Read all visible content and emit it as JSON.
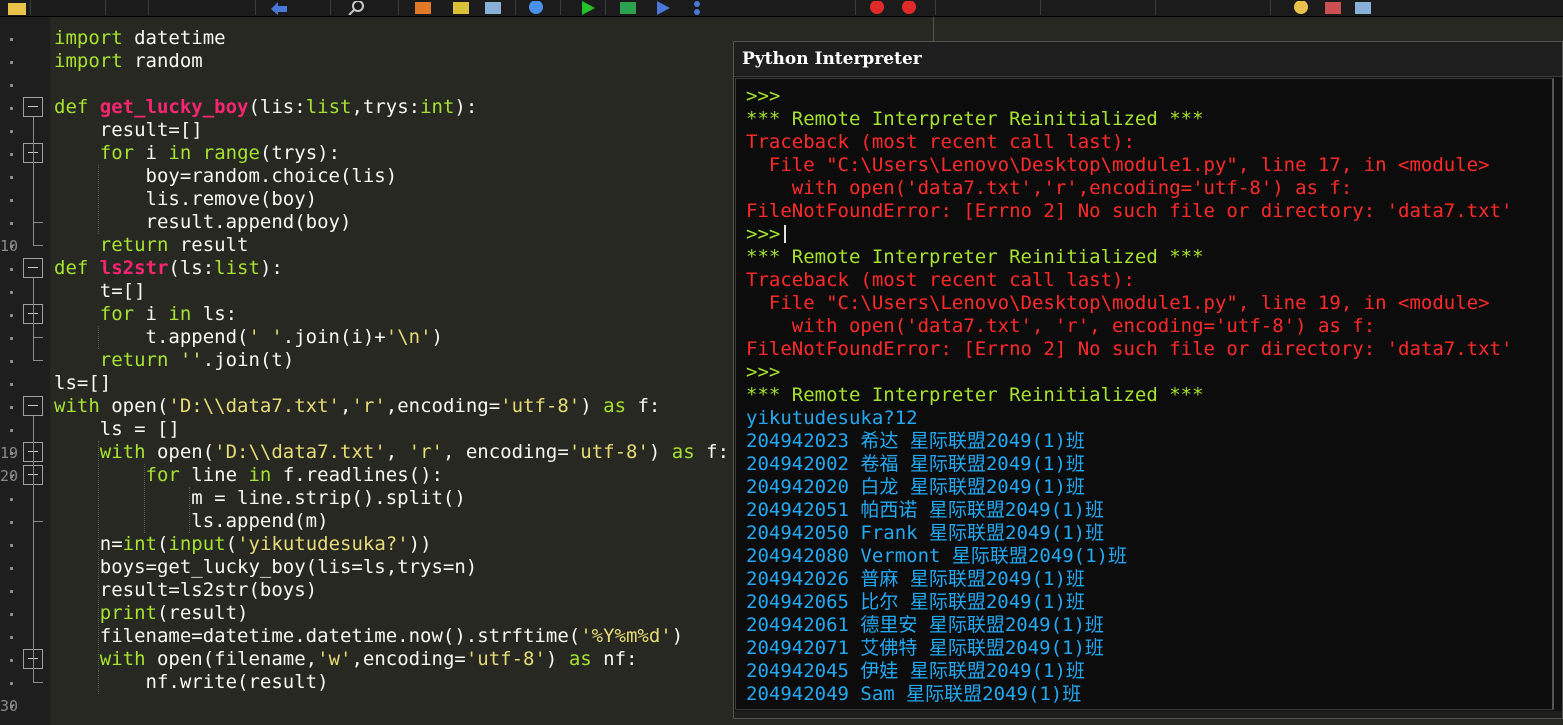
{
  "interpreter": {
    "title": "Python Interpreter",
    "lines": [
      {
        "cls": "prompt",
        "text": ">>>"
      },
      {
        "cls": "reinit",
        "text": "*** Remote Interpreter Reinitialized ***"
      },
      {
        "cls": "err",
        "text": "Traceback (most recent call last):"
      },
      {
        "cls": "err",
        "text": "  File \"C:\\Users\\Lenovo\\Desktop\\module1.py\", line 17, in <module>"
      },
      {
        "cls": "err",
        "text": "    with open('data7.txt','r',encoding='utf-8') as f:"
      },
      {
        "cls": "err",
        "text": "FileNotFoundError: [Errno 2] No such file or directory: 'data7.txt'"
      },
      {
        "cls": "prompt",
        "text": ">>>",
        "cursor": true
      },
      {
        "cls": "reinit",
        "text": "*** Remote Interpreter Reinitialized ***"
      },
      {
        "cls": "err",
        "text": "Traceback (most recent call last):"
      },
      {
        "cls": "err",
        "text": "  File \"C:\\Users\\Lenovo\\Desktop\\module1.py\", line 19, in <module>"
      },
      {
        "cls": "err",
        "text": "    with open('data7.txt', 'r', encoding='utf-8') as f:"
      },
      {
        "cls": "err",
        "text": "FileNotFoundError: [Errno 2] No such file or directory: 'data7.txt'"
      },
      {
        "cls": "prompt",
        "text": ">>>"
      },
      {
        "cls": "reinit",
        "text": "*** Remote Interpreter Reinitialized ***"
      },
      {
        "cls": "out",
        "text": "yikutudesuka?12"
      },
      {
        "cls": "out",
        "text": "204942023 希达 星际联盟2049(1)班"
      },
      {
        "cls": "out",
        "text": "204942002 卷福 星际联盟2049(1)班"
      },
      {
        "cls": "out",
        "text": "204942020 白龙 星际联盟2049(1)班"
      },
      {
        "cls": "out",
        "text": "204942051 帕西诺 星际联盟2049(1)班"
      },
      {
        "cls": "out",
        "text": "204942050 Frank 星际联盟2049(1)班"
      },
      {
        "cls": "out",
        "text": "204942080 Vermont 星际联盟2049(1)班"
      },
      {
        "cls": "out",
        "text": "204942026 普麻 星际联盟2049(1)班"
      },
      {
        "cls": "out",
        "text": "204942065 比尔 星际联盟2049(1)班"
      },
      {
        "cls": "out",
        "text": "204942061 德里安 星际联盟2049(1)班"
      },
      {
        "cls": "out",
        "text": "204942071 艾佛特 星际联盟2049(1)班"
      },
      {
        "cls": "out",
        "text": "204942045 伊娃 星际联盟2049(1)班"
      },
      {
        "cls": "out",
        "text": "204942049 Sam 星际联盟2049(1)班"
      }
    ]
  },
  "gutter": {
    "line_numbers": [
      {
        "text": "10",
        "row": 9
      },
      {
        "text": "19",
        "row": 18
      },
      {
        "text": "20",
        "row": 19
      },
      {
        "text": "30",
        "row": 29
      }
    ]
  },
  "code_lines": [
    [
      [
        "kw",
        "import"
      ],
      [
        "pl",
        " datetime"
      ]
    ],
    [
      [
        "kw",
        "import"
      ],
      [
        "pl",
        " random"
      ]
    ],
    [],
    [
      [
        "kw",
        "def "
      ],
      [
        "fn",
        "get_lucky_boy"
      ],
      [
        "pl",
        "(lis:"
      ],
      [
        "tp",
        "list"
      ],
      [
        "pl",
        ",trys:"
      ],
      [
        "tp",
        "int"
      ],
      [
        "pl",
        "):"
      ]
    ],
    [
      [
        "pl",
        "    result=[]"
      ]
    ],
    [
      [
        "pl",
        "    "
      ],
      [
        "kw",
        "for"
      ],
      [
        "pl",
        " i "
      ],
      [
        "kw",
        "in"
      ],
      [
        "pl",
        " "
      ],
      [
        "kw",
        "range"
      ],
      [
        "pl",
        "(trys):"
      ]
    ],
    [
      [
        "pl",
        "        boy=random.choice(lis)"
      ]
    ],
    [
      [
        "pl",
        "        lis.remove(boy)"
      ]
    ],
    [
      [
        "pl",
        "        result.append(boy)"
      ]
    ],
    [
      [
        "pl",
        "    "
      ],
      [
        "kw",
        "return"
      ],
      [
        "pl",
        " result"
      ]
    ],
    [
      [
        "kw",
        "def "
      ],
      [
        "fn",
        "ls2str"
      ],
      [
        "pl",
        "(ls:"
      ],
      [
        "tp",
        "list"
      ],
      [
        "pl",
        "):"
      ]
    ],
    [
      [
        "pl",
        "    t=[]"
      ]
    ],
    [
      [
        "pl",
        "    "
      ],
      [
        "kw",
        "for"
      ],
      [
        "pl",
        " i "
      ],
      [
        "kw",
        "in"
      ],
      [
        "pl",
        " ls:"
      ]
    ],
    [
      [
        "pl",
        "        t.append("
      ],
      [
        "str",
        "' '"
      ],
      [
        "pl",
        ".join(i)+"
      ],
      [
        "str",
        "'\\n'"
      ],
      [
        "pl",
        ")"
      ]
    ],
    [
      [
        "pl",
        "    "
      ],
      [
        "kw",
        "return"
      ],
      [
        "pl",
        " "
      ],
      [
        "str",
        "''"
      ],
      [
        "pl",
        ".join(t)"
      ]
    ],
    [
      [
        "pl",
        "ls=[]"
      ]
    ],
    [
      [
        "kw",
        "with"
      ],
      [
        "pl",
        " open("
      ],
      [
        "str",
        "'D:\\\\data7.txt'"
      ],
      [
        "pl",
        ","
      ],
      [
        "str",
        "'r'"
      ],
      [
        "pl",
        ",encoding="
      ],
      [
        "str",
        "'utf-8'"
      ],
      [
        "pl",
        ") "
      ],
      [
        "kw",
        "as"
      ],
      [
        "pl",
        " f:"
      ]
    ],
    [
      [
        "pl",
        "    ls = []"
      ]
    ],
    [
      [
        "pl",
        "    "
      ],
      [
        "kw",
        "with"
      ],
      [
        "pl",
        " open("
      ],
      [
        "str",
        "'D:\\\\data7.txt'"
      ],
      [
        "pl",
        ", "
      ],
      [
        "str",
        "'r'"
      ],
      [
        "pl",
        ", encoding="
      ],
      [
        "str",
        "'utf-8'"
      ],
      [
        "pl",
        ") "
      ],
      [
        "kw",
        "as"
      ],
      [
        "pl",
        " f:"
      ]
    ],
    [
      [
        "pl",
        "        "
      ],
      [
        "kw",
        "for"
      ],
      [
        "pl",
        " line "
      ],
      [
        "kw",
        "in"
      ],
      [
        "pl",
        " f.readlines():"
      ]
    ],
    [
      [
        "pl",
        "            m = line.strip().split()"
      ]
    ],
    [
      [
        "pl",
        "            ls.append(m)"
      ]
    ],
    [
      [
        "pl",
        "    n="
      ],
      [
        "kw",
        "int"
      ],
      [
        "pl",
        "("
      ],
      [
        "kw",
        "input"
      ],
      [
        "pl",
        "("
      ],
      [
        "str",
        "'yikutudesuka?'"
      ],
      [
        "pl",
        "))"
      ]
    ],
    [
      [
        "pl",
        "    boys=get_lucky_boy(lis=ls,trys=n)"
      ]
    ],
    [
      [
        "pl",
        "    result=ls2str(boys)"
      ]
    ],
    [
      [
        "pl",
        "    "
      ],
      [
        "kw",
        "print"
      ],
      [
        "pl",
        "(result)"
      ]
    ],
    [
      [
        "pl",
        "    filename=datetime.datetime.now().strftime("
      ],
      [
        "str",
        "'%Y%m%d'"
      ],
      [
        "pl",
        ")"
      ]
    ],
    [
      [
        "pl",
        "    "
      ],
      [
        "kw",
        "with"
      ],
      [
        "pl",
        " open(filename,"
      ],
      [
        "str",
        "'w'"
      ],
      [
        "pl",
        ",encoding="
      ],
      [
        "str",
        "'utf-8'"
      ],
      [
        "pl",
        ") "
      ],
      [
        "kw",
        "as"
      ],
      [
        "pl",
        " nf:"
      ]
    ],
    [
      [
        "pl",
        "        nf.write(result)"
      ]
    ]
  ],
  "toolbar_icons": [
    {
      "name": "open-folder-icon",
      "color": "#e8c24a",
      "shape": "folder"
    },
    {
      "name": "undo-icon",
      "color": "#4a78d8",
      "shape": "arrow"
    },
    {
      "name": "find-icon",
      "color": "#c8c8c8",
      "shape": "glass"
    },
    {
      "name": "tool-icon-1",
      "color": "#e07a2a",
      "shape": "box"
    },
    {
      "name": "tool-icon-2",
      "color": "#d8c23a",
      "shape": "box"
    },
    {
      "name": "tool-icon-3",
      "color": "#8ab0d8",
      "shape": "box"
    },
    {
      "name": "comment-icon",
      "color": "#4a90e8",
      "shape": "circle"
    },
    {
      "name": "run-icon",
      "color": "#22c02a",
      "shape": "play"
    },
    {
      "name": "debug-icon",
      "color": "#2aa050",
      "shape": "box"
    },
    {
      "name": "step-icon",
      "color": "#4a78d8",
      "shape": "play"
    },
    {
      "name": "step-over-icon",
      "color": "#4a78d8",
      "shape": "dot"
    },
    {
      "name": "breakpoint-icon",
      "color": "#e02a2a",
      "shape": "circle"
    },
    {
      "name": "clear-breakpoints-icon",
      "color": "#e02a2a",
      "shape": "circle"
    },
    {
      "name": "python-icon",
      "color": "#e8c24a",
      "shape": "circle"
    },
    {
      "name": "layout-icon",
      "color": "#c85050",
      "shape": "box"
    },
    {
      "name": "save-layout-icon",
      "color": "#8ab0d8",
      "shape": "box"
    }
  ]
}
